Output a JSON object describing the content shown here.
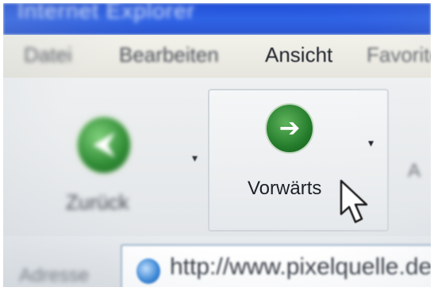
{
  "window": {
    "title": "Internet Explorer"
  },
  "menu": {
    "items": [
      "Datei",
      "Bearbeiten",
      "Ansicht",
      "Favoriten"
    ]
  },
  "toolbar": {
    "back_label": "Zurück",
    "forward_label": "Vorwärts",
    "next_label_partial": "A",
    "dropdown_glyph": "▾",
    "back_icon": "arrow-left-icon",
    "forward_icon": "arrow-right-icon"
  },
  "address_bar": {
    "label": "Adresse",
    "value": "http://www.pixelquelle.de/"
  },
  "colors": {
    "titlebar": "#2b56d0",
    "nav_green": "#2f8a34",
    "toolbar_bg": "#e6e9ec"
  }
}
